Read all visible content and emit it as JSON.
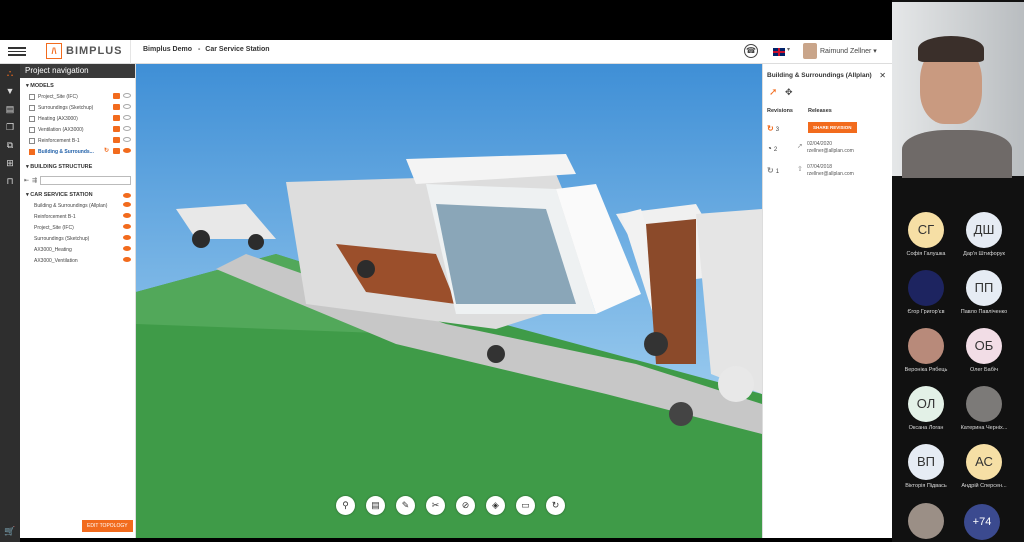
{
  "app": {
    "logo": "BIMPLUS",
    "project": "Bimplus Demo",
    "model": "Car Service Station",
    "user": "Raimund Zellner"
  },
  "nav": {
    "title": "Project navigation",
    "models_header": "MODELS",
    "models": [
      {
        "label": "Project_Site (IFC)"
      },
      {
        "label": "Surroundings (Sketchup)"
      },
      {
        "label": "Heating (AX3000)"
      },
      {
        "label": "Ventilation (AX3000)"
      },
      {
        "label": "Reinforcement B-1"
      },
      {
        "label": "Building & Surrounds..."
      }
    ],
    "structure_header": "BUILDING STRUCTURE",
    "station": "CAR SERVICE STATION",
    "tree": [
      "Building & Surroundings (Allplan)",
      "Reinforcement B-1",
      "Project_Site (IFC)",
      "Surroundings (Sketchup)",
      "AX3000_Heating",
      "AX3000_Ventilation"
    ],
    "edit_topology": "EDIT TOPOLOGY"
  },
  "right": {
    "title": "Building & Surroundings (Allplan)",
    "revisions_label": "Revisions",
    "releases_label": "Releases",
    "share_revision": "SHARE REVISION",
    "rev": [
      "3",
      "2",
      "1"
    ],
    "releases": [
      {
        "date": "02/04/2020",
        "email": "rzellner@allplan.com"
      },
      {
        "date": "07/04/2018",
        "email": "rzellner@allplan.com"
      }
    ]
  },
  "toolbar": [
    "pin-icon",
    "clipboard-icon",
    "ruler-icon",
    "scissors-icon",
    "hide-icon",
    "layers-icon",
    "camera-icon",
    "refresh-icon"
  ],
  "participants": [
    {
      "initials": "СГ",
      "name": "Софія Галушка",
      "color": "#f6dfa5"
    },
    {
      "initials": "ДШ",
      "name": "Дар'я Штифорук",
      "color": "#e6ecf4"
    },
    {
      "initials": "",
      "name": "Єгор Григор'єв",
      "color": "#1d2460"
    },
    {
      "initials": "ПП",
      "name": "Павло Павліченко",
      "color": "#e6ecf4"
    },
    {
      "initials": "",
      "name": "Вероніка Рябець",
      "color": "#b88a7a"
    },
    {
      "initials": "ОБ",
      "name": "Олег Бабіч",
      "color": "#f2dde6"
    },
    {
      "initials": "ОЛ",
      "name": "Оксана Логан",
      "color": "#e3f1e7"
    },
    {
      "initials": "",
      "name": "Катерина Черніх...",
      "color": "#7c7a78"
    },
    {
      "initials": "ВП",
      "name": "Вікторія Підвась",
      "color": "#e6ecf4"
    },
    {
      "initials": "АС",
      "name": "Андрій Сперсен...",
      "color": "#f6dfa5"
    },
    {
      "initials": "",
      "name": "",
      "color": "#9b8f86"
    }
  ],
  "more_count": "+74"
}
